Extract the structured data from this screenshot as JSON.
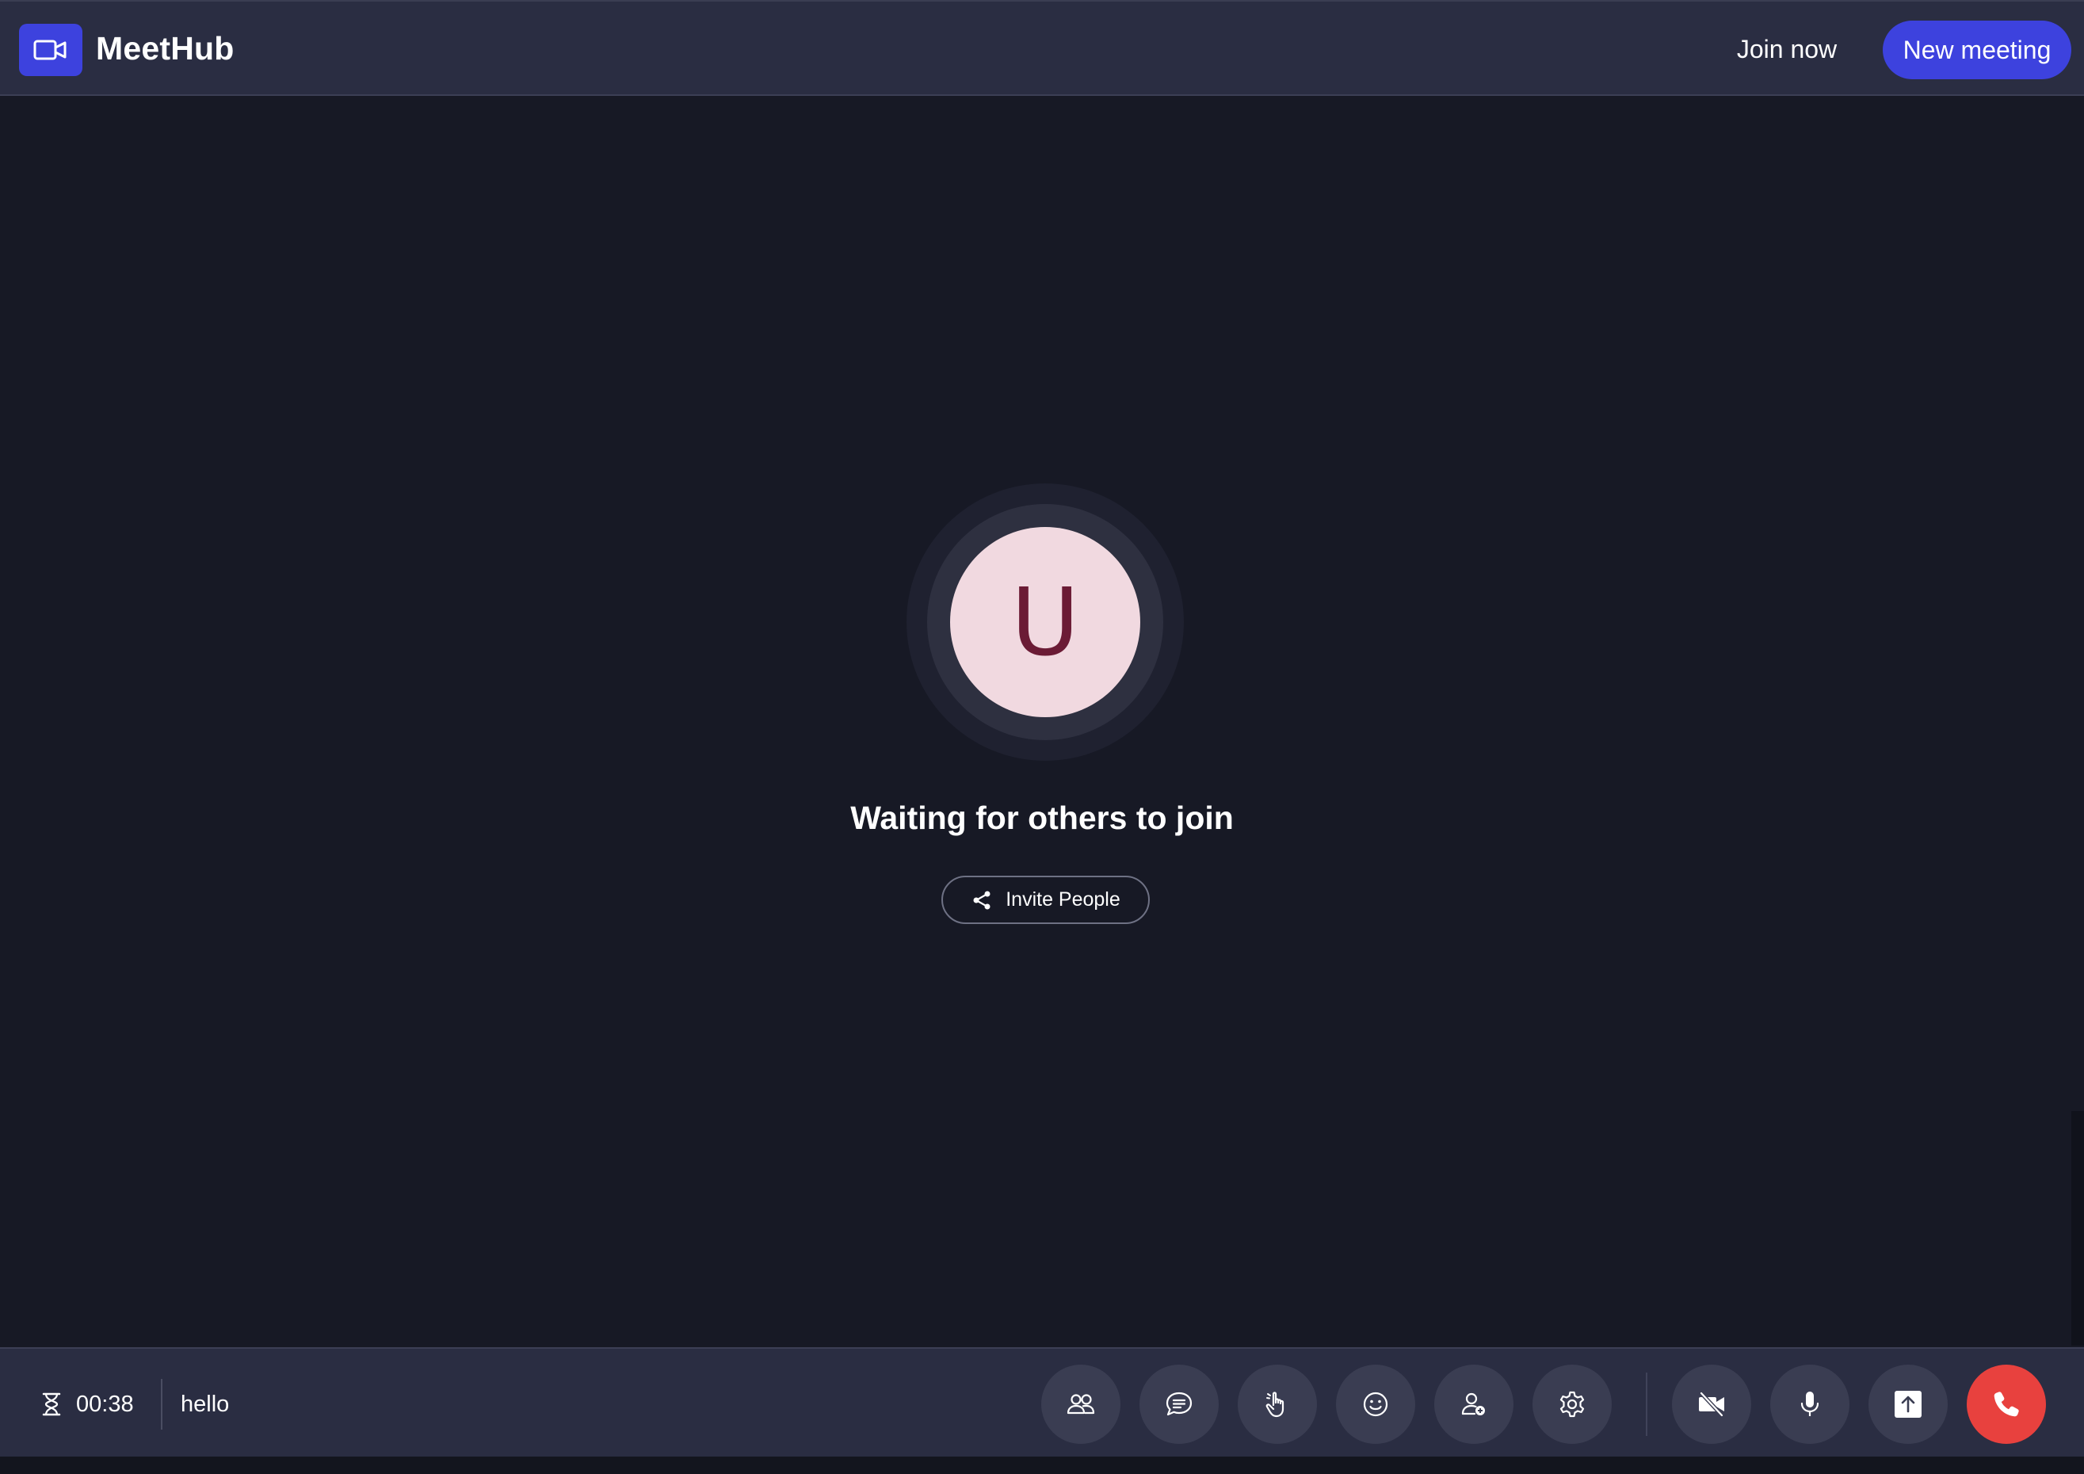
{
  "app": {
    "name": "MeetHub",
    "logo_icon": "video-camera-icon"
  },
  "header": {
    "join_now_label": "Join now",
    "new_meeting_label": "New meeting"
  },
  "stage": {
    "avatar_initial": "U",
    "status_text": "Waiting for others to join",
    "invite_label": "Invite People",
    "invite_icon": "share-icon"
  },
  "bottom_bar": {
    "timer": "00:38",
    "timer_icon": "hourglass-icon",
    "meeting_name": "hello",
    "controls": [
      {
        "name": "participants-button",
        "icon": "people-icon"
      },
      {
        "name": "chat-button",
        "icon": "chat-bubble-icon"
      },
      {
        "name": "raise-hand-button",
        "icon": "hand-icon"
      },
      {
        "name": "reactions-button",
        "icon": "smiley-icon"
      },
      {
        "name": "add-participant-button",
        "icon": "person-add-icon"
      },
      {
        "name": "settings-button",
        "icon": "gear-icon"
      },
      {
        "name": "camera-toggle-button",
        "icon": "video-off-icon"
      },
      {
        "name": "microphone-toggle-button",
        "icon": "microphone-icon"
      },
      {
        "name": "share-screen-button",
        "icon": "upload-icon"
      },
      {
        "name": "end-call-button",
        "icon": "phone-icon"
      }
    ]
  },
  "colors": {
    "background": "#171925",
    "bar": "#2a2d42",
    "accent": "#3d42de",
    "control_bg": "#3a3d52",
    "end_call": "#e8413e",
    "avatar_bg": "#f1d9e0",
    "avatar_text": "#6b1b35"
  }
}
